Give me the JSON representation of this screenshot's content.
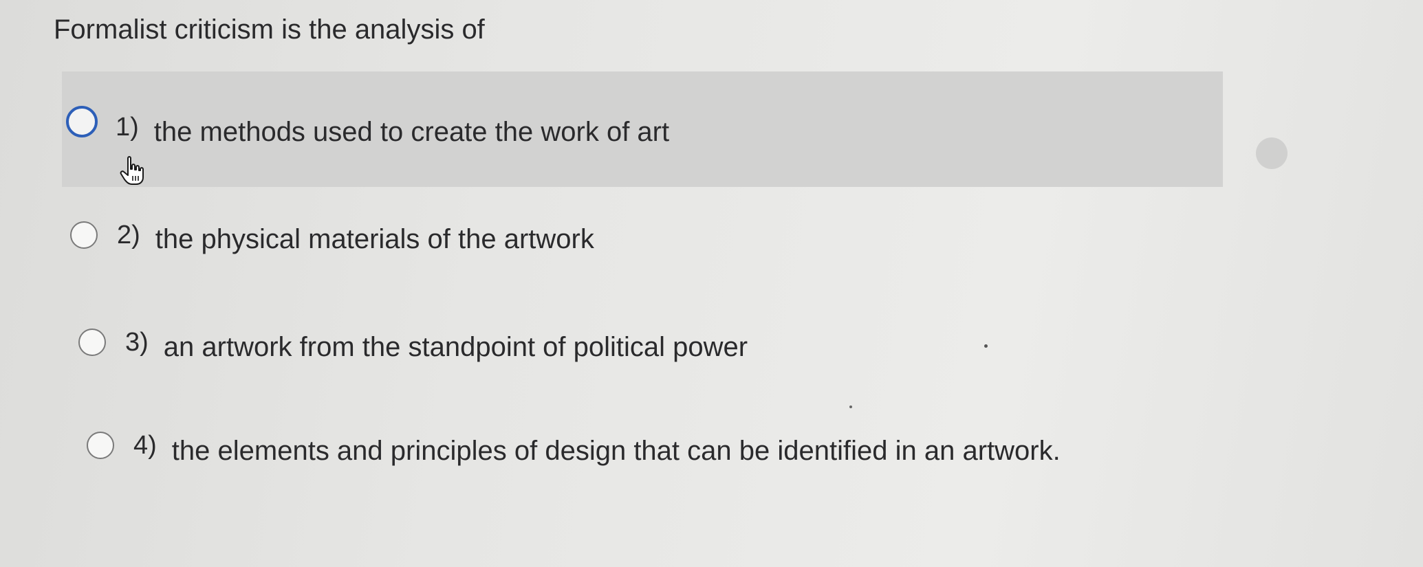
{
  "question": {
    "text": "Formalist criticism is the analysis of"
  },
  "options": [
    {
      "number": "1)",
      "text": "the methods used to create the work of art",
      "highlighted": true
    },
    {
      "number": "2)",
      "text": "the physical materials of the artwork",
      "highlighted": false
    },
    {
      "number": "3)",
      "text": "an artwork from the standpoint of political power",
      "highlighted": false
    },
    {
      "number": "4)",
      "text": "the elements and principles of design that can be identified in an artwork.",
      "highlighted": false
    }
  ],
  "cursor": {
    "icon": "hand-pointer-icon"
  },
  "colors": {
    "focus_ring": "#2d5fb8",
    "highlight_row": "#d2d2d1",
    "text": "#2a2a2c"
  }
}
